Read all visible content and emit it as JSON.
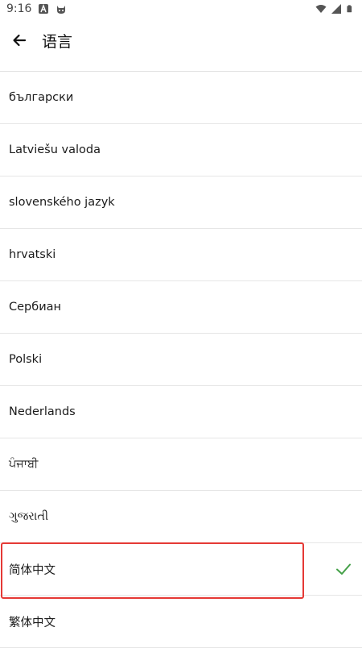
{
  "status_bar": {
    "time": "9:16"
  },
  "header": {
    "title": "语言"
  },
  "languages": [
    {
      "label": "български",
      "selected": false
    },
    {
      "label": "Latviešu valoda",
      "selected": false
    },
    {
      "label": "slovenského jazyk",
      "selected": false
    },
    {
      "label": "hrvatski",
      "selected": false
    },
    {
      "label": "Сербиан",
      "selected": false
    },
    {
      "label": "Polski",
      "selected": false
    },
    {
      "label": "Nederlands",
      "selected": false
    },
    {
      "label": "ਪੰਜਾਬੀ",
      "selected": false
    },
    {
      "label": "ગુજરાતી",
      "selected": false
    },
    {
      "label": "简体中文",
      "selected": true
    },
    {
      "label": "繁体中文",
      "selected": false
    }
  ],
  "colors": {
    "check": "#43a047",
    "highlight": "#e53935"
  },
  "icons": {
    "back": "arrow-left-icon",
    "selected": "check-icon"
  }
}
